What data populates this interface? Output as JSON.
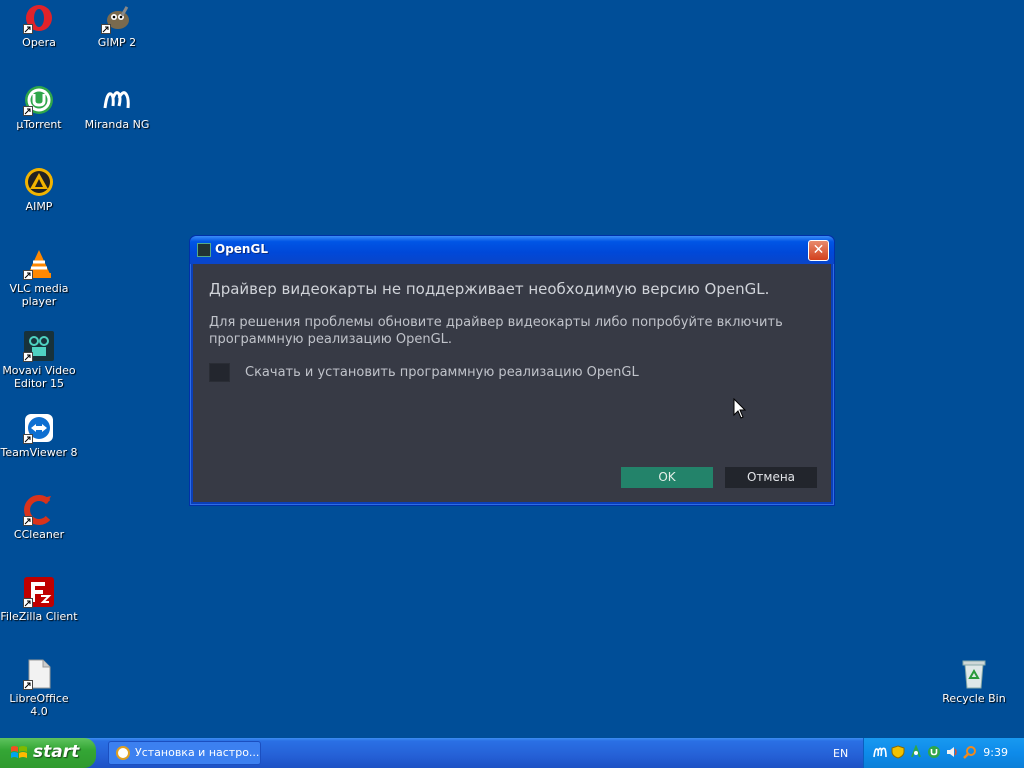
{
  "desktop": {
    "icons": [
      {
        "label": "Opera"
      },
      {
        "label": "GIMP 2"
      },
      {
        "label": "µTorrent"
      },
      {
        "label": "Miranda NG"
      },
      {
        "label": "AIMP"
      },
      {
        "label": "VLC media player"
      },
      {
        "label": "Movavi Video Editor 15"
      },
      {
        "label": "TeamViewer 8"
      },
      {
        "label": "CCleaner"
      },
      {
        "label": "FileZilla Client"
      },
      {
        "label": "LibreOffice 4.0"
      },
      {
        "label": "Recycle Bin"
      }
    ]
  },
  "dialog": {
    "title": "OpenGL",
    "close_label": "✕",
    "heading": "Драйвер видеокарты не поддерживает необходимую версию OpenGL.",
    "description": "Для решения проблемы обновите драйвер видеокарты либо попробуйте включить программную реализацию OpenGL.",
    "checkbox_label": "Скачать и установить программную реализацию OpenGL",
    "checkbox_checked": false,
    "ok_label": "OK",
    "cancel_label": "Отмена"
  },
  "taskbar": {
    "start_label": "start",
    "task_label": "Установка и настро...",
    "language": "EN",
    "clock": "9:39",
    "tray_icons": [
      "miranda-icon",
      "shield-icon",
      "network-icon",
      "utorrent-icon",
      "volume-icon",
      "search-icon"
    ]
  },
  "colors": {
    "desktop_bg": "#004e98",
    "dialog_bg": "#373a45",
    "ok_button": "#23836a",
    "cancel_button": "#22252c"
  }
}
